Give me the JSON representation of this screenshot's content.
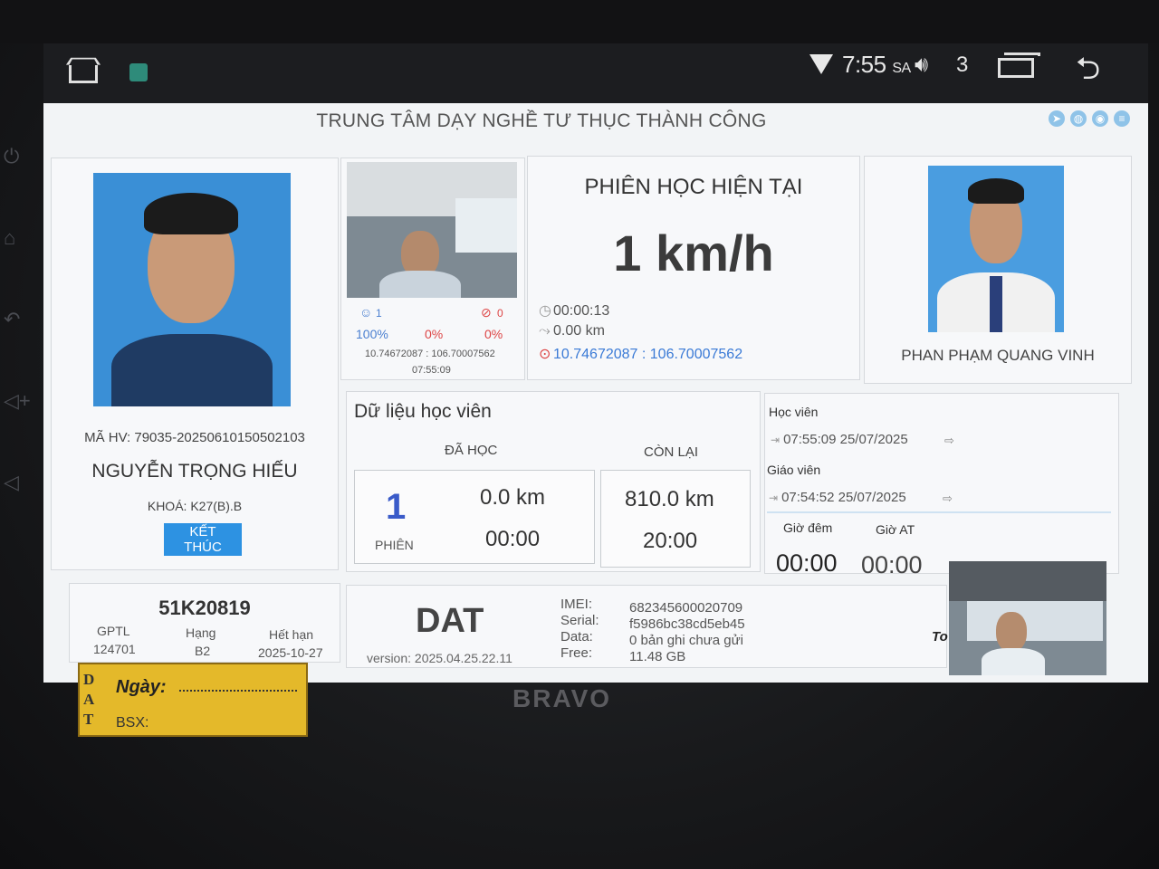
{
  "status_bar": {
    "time": "7:55",
    "time_suffix": "SA",
    "volume_level": "3",
    "icons": [
      "home-icon",
      "app-icon",
      "wifi-icon",
      "volume-icon",
      "recents-icon",
      "back-icon"
    ]
  },
  "app": {
    "title": "TRUNG TÂM DẠY NGHỀ TƯ THỤC THÀNH CÔNG",
    "toolbar_icons": [
      "navigation-icon",
      "globe-icon",
      "camera-icon",
      "database-icon"
    ]
  },
  "student": {
    "code": "MÃ HV: 79035-20250610150502103",
    "name": "NGUYỄN TRỌNG HIẾU",
    "course": "KHOÁ: K27(B).B",
    "end_button": "KẾT THÚC"
  },
  "camera": {
    "face_count": "1",
    "face_pct": "100%",
    "warn_pct": "0%",
    "err_count": "0",
    "err_pct": "0%",
    "coords": "10.74672087 : 106.70007562",
    "time": "07:55:09"
  },
  "session": {
    "title": "PHIÊN HỌC HIỆN TẠI",
    "speed": "1 km/h",
    "duration": "00:00:13",
    "distance": "0.00 km",
    "gps": "10.74672087 : 106.70007562"
  },
  "teacher": {
    "name": "PHAN PHẠM QUANG VINH"
  },
  "student_data": {
    "title": "Dữ liệu học viên",
    "learned_header": "ĐÃ HỌC",
    "remaining_header": "CÒN LẠI",
    "sessions": "1",
    "sessions_label": "PHIÊN",
    "learned_km": "0.0 km",
    "learned_time": "00:00",
    "remaining_km": "810.0 km",
    "remaining_time": "20:00"
  },
  "login_log": {
    "student_label": "Học viên",
    "student_time": "07:55:09 25/07/2025",
    "teacher_label": "Giáo viên",
    "teacher_time": "07:54:52 25/07/2025",
    "night_label": "Giờ đêm",
    "night_value": "00:00",
    "auto_label": "Giờ AT",
    "auto_value": "00:00"
  },
  "vehicle": {
    "plate": "51K20819",
    "gptl_label": "GPTL",
    "gptl_value": "124701",
    "rank_label": "Hạng",
    "rank_value": "B2",
    "expiry_label": "Hết hạn",
    "expiry_value": "2025-10-27"
  },
  "device": {
    "name": "DAT",
    "version": "version: 2025.04.25.22.11",
    "imei_label": "IMEI:",
    "imei_value": "682345600020709",
    "serial_label": "Serial:",
    "serial_value": "f5986bc38cd5eb45",
    "data_label": "Data:",
    "data_value": "0 bản ghi chưa gửi",
    "free_label": "Free:",
    "free_value": "11.48 GB",
    "cam_overlay": "To"
  },
  "sticker": {
    "side_text": "D A T",
    "date_label": "Ngày:",
    "plate_label": "BSX:"
  },
  "brand": "BRAVO"
}
